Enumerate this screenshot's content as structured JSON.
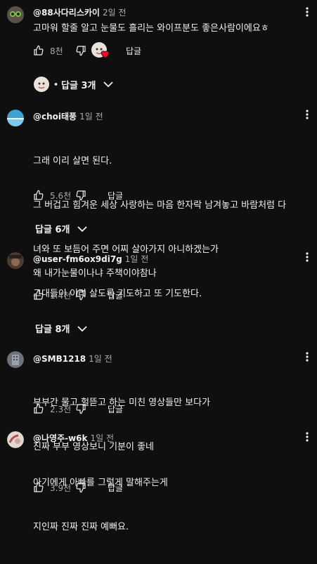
{
  "comments": [
    {
      "author": "@88사다리스카이",
      "time": "2일 전",
      "text": "고마워 할줄 알고 눈물도 흘리는 와이프분도 좋은사람이에요ㅎ",
      "likes": "8천",
      "reply_label": "답글",
      "replies_label": "답글 3개",
      "replies_dot": "•",
      "avatar_color": "#5a5248",
      "hearted": true
    },
    {
      "author": "@choi태풍",
      "time": "1일 전",
      "text_lines": [
        "그래 이리 살면 된다.",
        "그 버겁고 힘겨운 세상 사랑하는 마음 한자락 남겨놓고 바람처럼 다",
        "녀와 또 보듬어 주면 어찌 살아가지 아니하겠는가",
        "그대들이 이리 살도록 기도하고 또 기도한다."
      ],
      "likes": "5.6천",
      "reply_label": "답글",
      "replies_label": "답글 6개",
      "avatar_color": "#3aa3d8"
    },
    {
      "author": "@user-fm6ox9di7g",
      "time": "1일 전",
      "text": "왜 내가눈물이나냐 주책이야참나",
      "likes": "1.4천",
      "reply_label": "답글",
      "replies_label": "답글 8개",
      "avatar_color": "#4a3a30"
    },
    {
      "author": "@SMB1218",
      "time": "1일 전",
      "text_lines": [
        "부부간 물고 헐뜯고 하는 미친 영상들만 보다가",
        "진짜 부부 영상보니 기분이 좋네"
      ],
      "likes": "2.3천",
      "reply_label": "답글",
      "avatar_color": "#6d7280"
    },
    {
      "author": "@나영주-w6k",
      "time": "1일 전",
      "text_lines": [
        "아기에게 아빠를 그렇게 말해주는게",
        "지인짜 진짜 진짜 예뻐요."
      ],
      "likes": "3.9천",
      "reply_label": "답글",
      "avatar_color": "#c9a89a"
    }
  ],
  "icons": {
    "like": "thumb-up-icon",
    "dislike": "thumb-down-icon",
    "more": "more-vert-icon",
    "expand": "chevron-down-icon",
    "heart": "heart-icon"
  },
  "colors": {
    "background": "#0f0f0f",
    "text": "#f1f1f1",
    "secondary": "#aaaaaa",
    "heart": "#ff0033"
  }
}
